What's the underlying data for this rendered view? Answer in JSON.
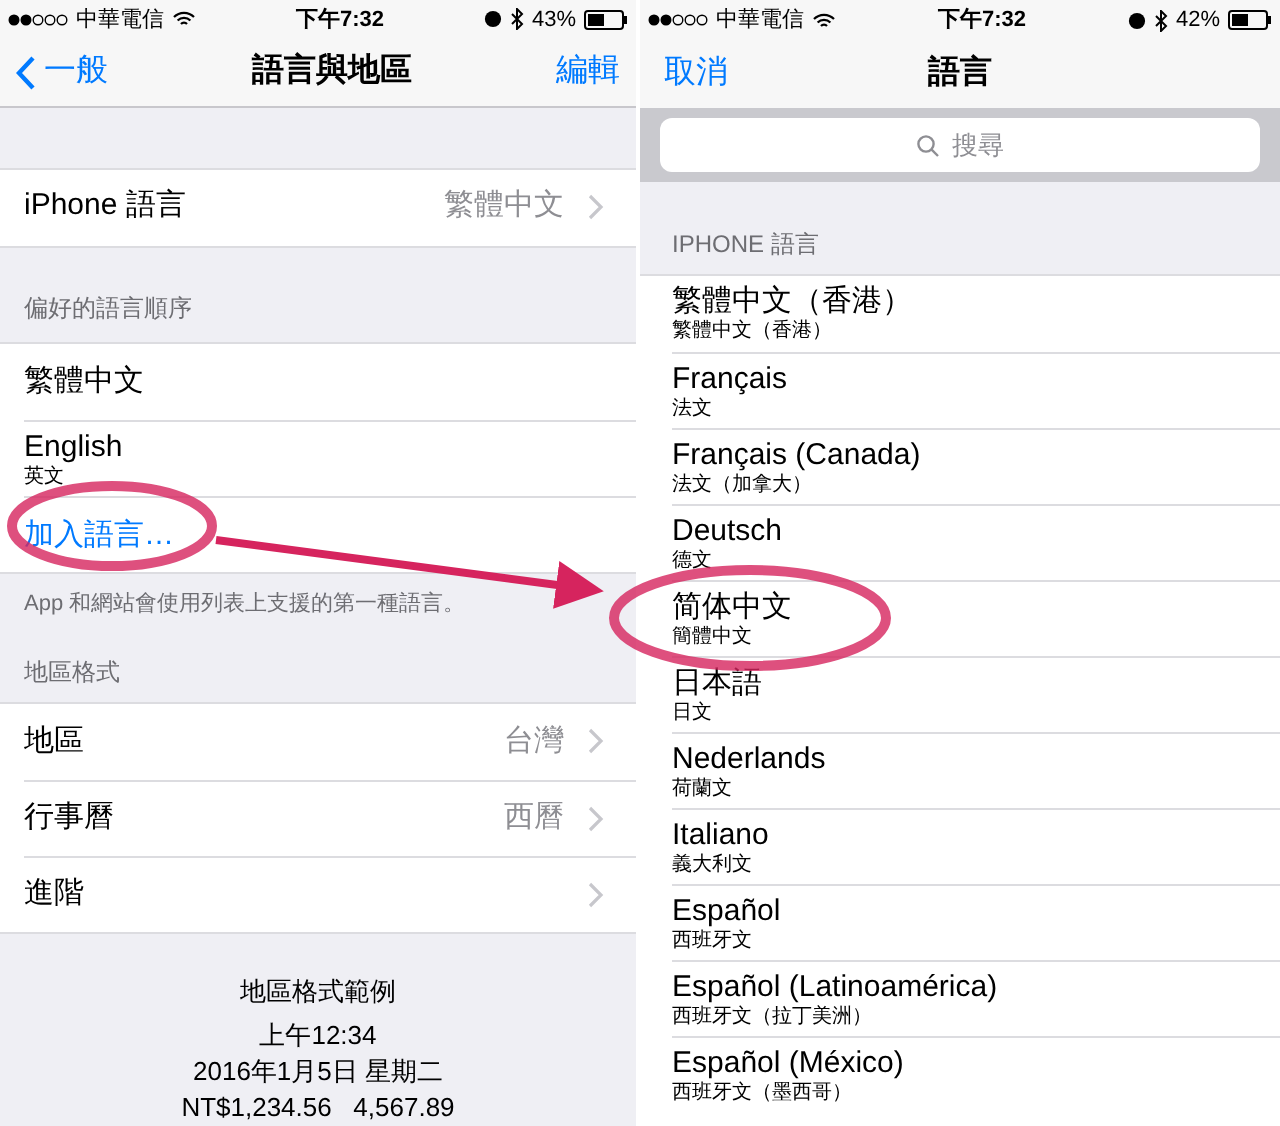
{
  "left": {
    "status": {
      "carrier": "中華電信",
      "time": "下午7:32",
      "battery": "43%"
    },
    "nav": {
      "back": "一般",
      "title": "語言與地區",
      "action": "編輯"
    },
    "iphone_language": {
      "label": "iPhone 語言",
      "value": "繁體中文"
    },
    "preferred": {
      "header": "偏好的語言順序",
      "languages": [
        {
          "name": "繁體中文"
        },
        {
          "name": "English",
          "native": "英文"
        }
      ],
      "add": "加入語言…",
      "footer": "App 和網站會使用列表上支援的第一種語言。"
    },
    "region": {
      "header": "地區格式",
      "rows": [
        {
          "label": "地區",
          "value": "台灣"
        },
        {
          "label": "行事曆",
          "value": "西曆"
        },
        {
          "label": "進階"
        }
      ]
    },
    "sample": {
      "title": "地區格式範例",
      "lines": [
        "上午12:34",
        "2016年1月5日 星期二",
        "NT$1,234.56   4,567.89"
      ]
    }
  },
  "right": {
    "status": {
      "carrier": "中華電信",
      "time": "下午7:32",
      "battery": "42%"
    },
    "nav": {
      "cancel": "取消",
      "title": "語言"
    },
    "search": {
      "placeholder": "搜尋"
    },
    "header": "IPHONE 語言",
    "languages": [
      {
        "name": "繁體中文（香港）",
        "native": "繁體中文（香港）"
      },
      {
        "name": "Français",
        "native": "法文"
      },
      {
        "name": "Français (Canada)",
        "native": "法文（加拿大）"
      },
      {
        "name": "Deutsch",
        "native": "德文"
      },
      {
        "name": "简体中文",
        "native": "簡體中文"
      },
      {
        "name": "日本語",
        "native": "日文"
      },
      {
        "name": "Nederlands",
        "native": "荷蘭文"
      },
      {
        "name": "Italiano",
        "native": "義大利文"
      },
      {
        "name": "Español",
        "native": "西班牙文"
      },
      {
        "name": "Español (Latinoamérica)",
        "native": "西班牙文（拉丁美洲）"
      },
      {
        "name": "Español (México)",
        "native": "西班牙文（墨西哥）"
      }
    ]
  }
}
